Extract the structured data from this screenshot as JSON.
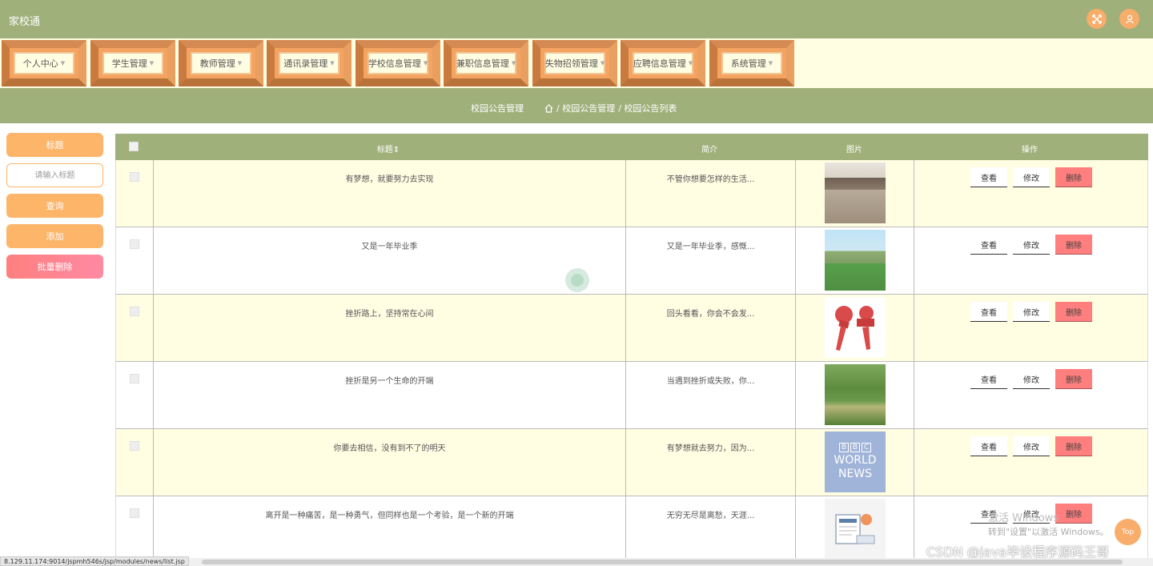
{
  "header": {
    "app_title": "家校通",
    "fullscreen_icon": "fullscreen-icon",
    "user_icon": "user-icon"
  },
  "menu": {
    "items": [
      {
        "label": "个人中心"
      },
      {
        "label": "学生管理"
      },
      {
        "label": "教师管理"
      },
      {
        "label": "通讯录管理"
      },
      {
        "label": "学校信息管理"
      },
      {
        "label": "兼职信息管理"
      },
      {
        "label": "失物招领管理"
      },
      {
        "label": "应聘信息管理"
      },
      {
        "label": "系统管理"
      }
    ]
  },
  "breadcrumb": {
    "title": "校园公告管理",
    "home_icon": "home-icon",
    "path1": "/ 校园公告管理",
    "path2": "/ 校园公告列表"
  },
  "search": {
    "field_label": "标题",
    "placeholder": "请输入标题",
    "query_label": "查询",
    "add_label": "添加",
    "batch_delete_label": "批量删除"
  },
  "table": {
    "headers": {
      "title": "标题",
      "sort_icon": "sort-icon",
      "intro": "简介",
      "image": "图片",
      "actions": "操作"
    },
    "rows": [
      {
        "title": "有梦想，就要努力去实现",
        "intro": "不管你想要怎样的生活...",
        "image": "classroom-image"
      },
      {
        "title": "又是一年毕业季",
        "intro": "又是一年毕业季，感慨...",
        "image": "campus-image"
      },
      {
        "title": "挫折路上，坚持常在心间",
        "intro": "回头看看，你会不会发...",
        "image": "microphone-image"
      },
      {
        "title": "挫折是另一个生命的开端",
        "intro": "当遇到挫折或失败，你...",
        "image": "forest-path-image"
      },
      {
        "title": "你要去相信，没有到不了的明天",
        "intro": "有梦想就去努力，因为...",
        "image": "bbc-world-news-image"
      },
      {
        "title": "离开是一种痛苦，是一种勇气，但同样也是一个考验，是一个新的开端",
        "intro": "无穷无尽是离愁，天涯...",
        "image": "newspaper-image"
      }
    ],
    "view_label": "查看",
    "edit_label": "修改",
    "delete_label": "删除"
  },
  "bbc_logo": {
    "letters": [
      "B",
      "B",
      "C"
    ],
    "line1": "WORLD",
    "line2": "NEWS"
  },
  "overlay": {
    "activate_line1": "激活 Windows",
    "activate_line2": "转到\"设置\"以激活 Windows。",
    "csdn_watermark": "CSDN @java毕设程序源码王哥",
    "top_button": "Top"
  },
  "status_url": "8.129.11.174:9014/jspmh546s/jsp/modules/news/list.jsp",
  "colors": {
    "accent_green": "#9fb07a",
    "accent_orange": "#fdb56a",
    "row_highlight": "#fffde2",
    "delete_red": "#ff7e7e"
  }
}
